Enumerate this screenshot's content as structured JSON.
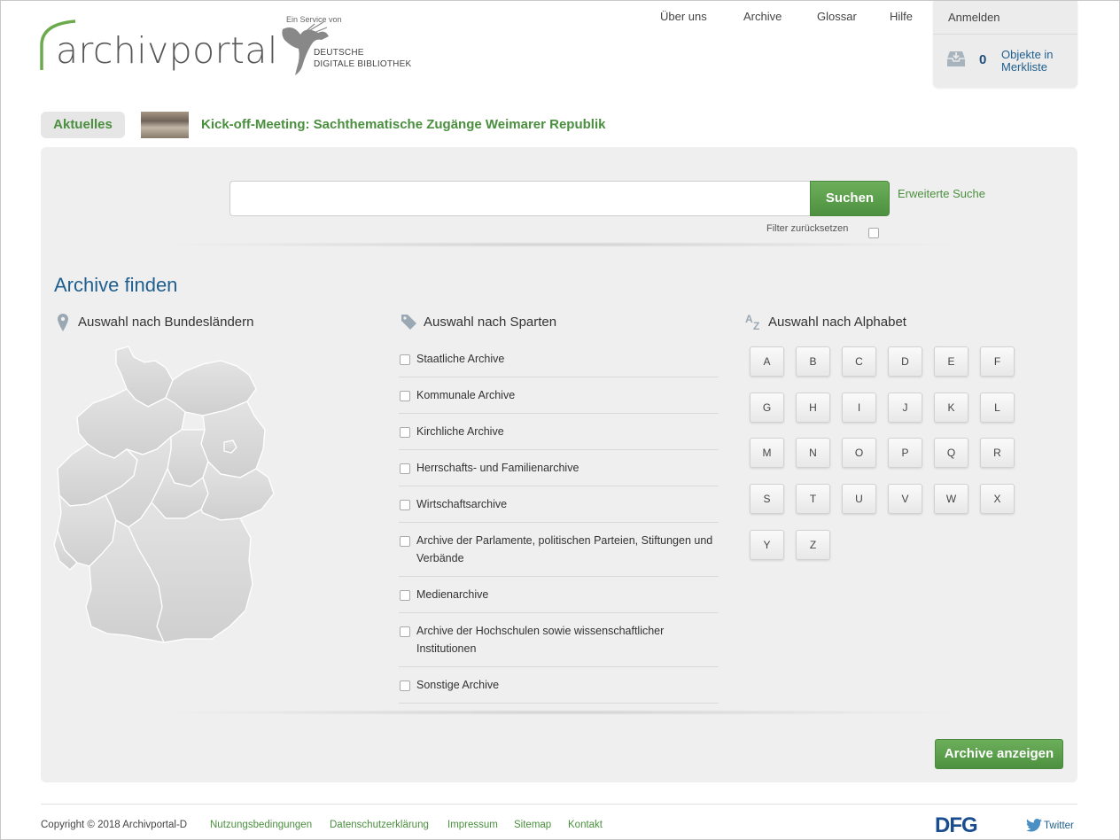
{
  "logo": {
    "text": "archivportal"
  },
  "partner": {
    "service": "Ein Service von",
    "line1": "DEUTSCHE",
    "line2": "DIGITALE BIBLIOTHEK"
  },
  "nav": {
    "items": [
      "Über uns",
      "Archive",
      "Glossar",
      "Hilfe"
    ],
    "login": "Anmelden"
  },
  "watchlist": {
    "count": "0",
    "label": "Objekte in Merkliste",
    "icon": "inbox-icon"
  },
  "news": {
    "tab": "Aktuelles",
    "title": "Kick-off-Meeting: Sachthematische Zugänge Weimarer Republik"
  },
  "search": {
    "value": "",
    "button": "Suchen",
    "advanced": "Erweiterte Suche",
    "filter_reset": "Filter zurücksetzen"
  },
  "archive_finder": {
    "title": "Archive finden",
    "states_heading": "Auswahl nach Bundesländern",
    "sparten_heading": "Auswahl nach Sparten",
    "alpha_heading": "Auswahl nach Alphabet",
    "sparten": [
      "Staatliche Archive",
      "Kommunale Archive",
      "Kirchliche Archive",
      "Herrschafts- und Familienarchive",
      "Wirtschaftsarchive",
      "Archive der Parlamente, politischen Parteien, Stiftungen und Verbände",
      "Medienarchive",
      "Archive der Hochschulen sowie wissenschaftlicher Institutionen",
      "Sonstige Archive"
    ],
    "letters": [
      "A",
      "B",
      "C",
      "D",
      "E",
      "F",
      "G",
      "H",
      "I",
      "J",
      "K",
      "L",
      "M",
      "N",
      "O",
      "P",
      "Q",
      "R",
      "S",
      "T",
      "U",
      "V",
      "W",
      "X",
      "Y",
      "Z"
    ],
    "show_button": "Archive anzeigen"
  },
  "footer": {
    "copyright": "Copyright © 2018 Archivportal-D",
    "links": [
      "Nutzungsbedingungen",
      "Datenschutzerklärung",
      "Impressum",
      "Sitemap",
      "Kontakt"
    ],
    "dfg": "DFG",
    "twitter": "Twitter"
  },
  "colors": {
    "green": "#4a8f3e",
    "blue": "#1f5f8f",
    "panel": "#efefef"
  }
}
